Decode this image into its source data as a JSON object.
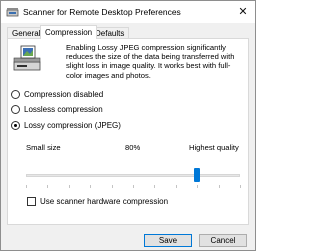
{
  "window": {
    "title": "Scanner for Remote Desktop Preferences",
    "close_glyph": "✕"
  },
  "tabs": [
    {
      "label": "General",
      "active": false
    },
    {
      "label": "Compression",
      "active": true
    },
    {
      "label": "Defaults",
      "active": false
    }
  ],
  "compression": {
    "description": "Enabling Lossy JPEG compression significantly reduces the size of the data being transferred with slight loss in image quality. It works best with full-color images and photos.",
    "options": [
      {
        "label": "Compression disabled",
        "selected": false
      },
      {
        "label": "Lossless compression",
        "selected": false
      },
      {
        "label": "Lossy compression (JPEG)",
        "selected": true
      }
    ],
    "slider": {
      "min_label": "Small size",
      "value_label": "80%",
      "max_label": "Highest quality",
      "value_fraction": 0.8
    },
    "hardware_compression": {
      "label": "Use scanner hardware compression",
      "checked": false
    }
  },
  "buttons": {
    "save": "Save",
    "cancel": "Cancel"
  },
  "colors": {
    "accent": "#0078d7"
  },
  "icons": {
    "app": "scanner-icon",
    "close": "close-icon"
  }
}
